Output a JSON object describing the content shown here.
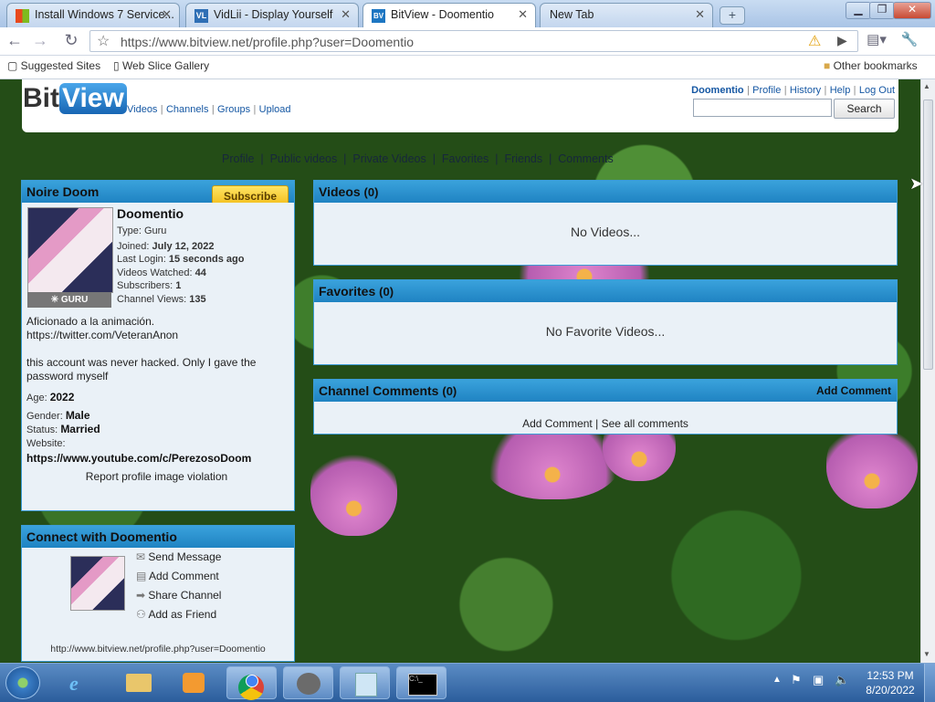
{
  "browser": {
    "tabs": [
      {
        "title": "Install Windows 7 Service..."
      },
      {
        "title": "VidLii - Display Yourself"
      },
      {
        "title": "BitView - Doomentio"
      },
      {
        "title": "New Tab"
      }
    ],
    "url": "https://www.bitview.net/profile.php?user=Doomentio",
    "bookmarks": {
      "suggested": "Suggested Sites",
      "webslice": "Web Slice Gallery",
      "other": "Other bookmarks"
    }
  },
  "header": {
    "logo": {
      "bit": "Bit",
      "view": "View"
    },
    "nav": [
      "Videos",
      "Channels",
      "Groups",
      "Upload"
    ],
    "user_links": [
      "Doomentio",
      "Profile",
      "History",
      "Help",
      "Log Out"
    ],
    "search_label": "Search"
  },
  "profile_nav": [
    "Profile",
    "Public videos",
    "Private Videos",
    "Favorites",
    "Friends",
    "Comments"
  ],
  "profile": {
    "display_name": "Noire Doom",
    "subscribe_label": "Subscribe",
    "username": "Doomentio",
    "type_label": "Type:",
    "type": "Guru",
    "joined_label": "Joined:",
    "joined": "July 12, 2022",
    "login_label": "Last Login:",
    "login": "15 seconds ago",
    "watched_label": "Videos Watched:",
    "watched": "44",
    "subs_label": "Subscribers:",
    "subs": "1",
    "views_label": "Channel Views:",
    "views": "135",
    "badge": "GURU",
    "bio1": "Aficionado a la animación.",
    "bio2": "https://twitter.com/VeteranAnon",
    "bio3": "this account was never hacked. Only I gave the password myself",
    "age_label": "Age:",
    "age": "2022",
    "gender_label": "Gender:",
    "gender": "Male",
    "status_label": "Status:",
    "status": "Married",
    "website_label": "Website:",
    "website": "https://www.youtube.com/c/PerezosoDoom",
    "report": "Report profile image violation"
  },
  "connect": {
    "title": "Connect with Doomentio",
    "actions": [
      "Send Message",
      "Add Comment",
      "Share Channel",
      "Add as Friend"
    ],
    "url": "http://www.bitview.net/profile.php?user=Doomentio"
  },
  "videos": {
    "title": "Videos",
    "count": "(0)",
    "empty": "No Videos..."
  },
  "favorites": {
    "title": "Favorites",
    "count": "(0)",
    "empty": "No Favorite Videos..."
  },
  "comments": {
    "title": "Channel Comments",
    "count": "(0)",
    "add": "Add Comment",
    "add2": "Add Comment",
    "see_all": "See all comments"
  },
  "taskbar": {
    "time": "12:53 PM",
    "date": "8/20/2022"
  }
}
